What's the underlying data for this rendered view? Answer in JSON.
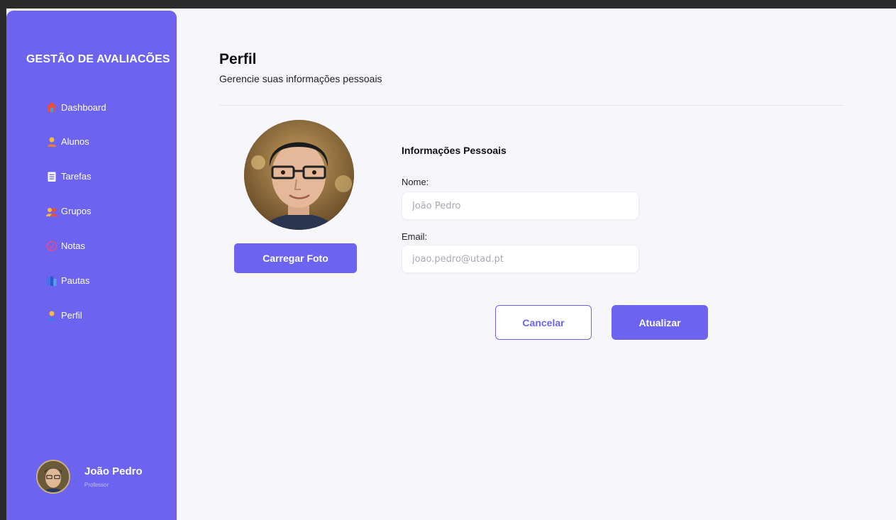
{
  "sidebar": {
    "brand": "GESTÃO DE AVALIACÕES",
    "items": [
      {
        "label": "Dashboard",
        "icon": "house-icon"
      },
      {
        "label": "Alunos",
        "icon": "student-icon"
      },
      {
        "label": "Tarefas",
        "icon": "clipboard-icon"
      },
      {
        "label": "Grupos",
        "icon": "group-icon"
      },
      {
        "label": "Notas",
        "icon": "grade-icon"
      },
      {
        "label": "Pautas",
        "icon": "books-icon"
      },
      {
        "label": "Perfil",
        "icon": "person-icon"
      }
    ],
    "profile": {
      "name": "João Pedro",
      "role": "Professor"
    }
  },
  "main": {
    "title": "Perfil",
    "subtitle": "Gerencie suas informações pessoais",
    "upload_label": "Carregar Foto",
    "section_title": "Informações Pessoais",
    "name_label": "Nome:",
    "name_placeholder": "João Pedro",
    "email_label": "Email:",
    "email_placeholder": "joao.pedro@utad.pt",
    "cancel_label": "Cancelar",
    "update_label": "Atualizar"
  },
  "colors": {
    "accent": "#6c63f0",
    "background": "#f7f7fb",
    "sidebar_text": "#ffffff"
  }
}
